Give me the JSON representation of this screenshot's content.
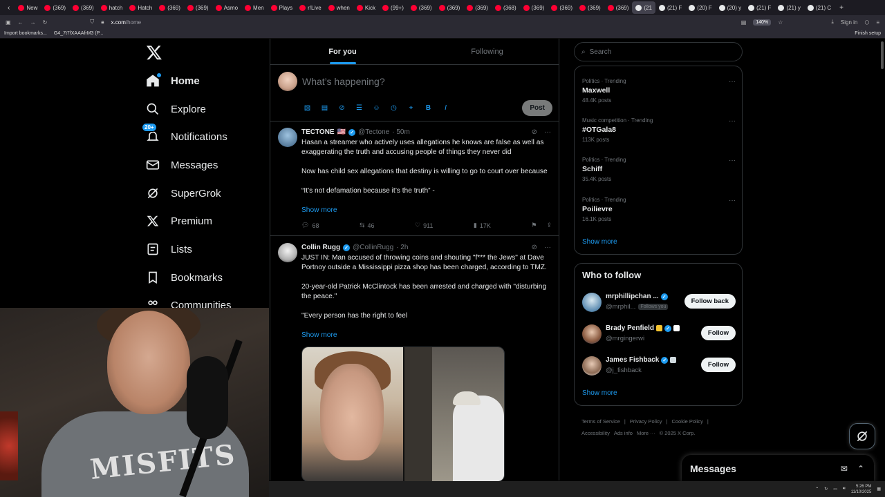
{
  "browser": {
    "tabs": [
      {
        "label": "New"
      },
      {
        "label": "(369)"
      },
      {
        "label": "(369)"
      },
      {
        "label": "hatch"
      },
      {
        "label": "Hatch"
      },
      {
        "label": "(369)"
      },
      {
        "label": "(369)"
      },
      {
        "label": "Asmo"
      },
      {
        "label": "Men"
      },
      {
        "label": "Plays"
      },
      {
        "label": "r/Live"
      },
      {
        "label": "when"
      },
      {
        "label": "Kick"
      },
      {
        "label": "(99+)"
      },
      {
        "label": "(369)"
      },
      {
        "label": "(369)"
      },
      {
        "label": "(369)"
      },
      {
        "label": "(368)"
      },
      {
        "label": "(369)"
      },
      {
        "label": "(369)"
      },
      {
        "label": "(369)"
      },
      {
        "label": "(369)"
      },
      {
        "label": "(21"
      },
      {
        "label": "(21) F"
      },
      {
        "label": "(20) F"
      },
      {
        "label": "(20) y"
      },
      {
        "label": "(21) F"
      },
      {
        "label": "(21) y"
      },
      {
        "label": "(21) C"
      }
    ],
    "url_host": "x.com",
    "url_path": "/home",
    "zoom": "140%",
    "sign_in": "Sign in",
    "bookmarks": [
      "Import bookmarks...",
      "G4_7t7fXAAAfrM3 (P..."
    ],
    "finish_setup": "Finish setup"
  },
  "nav": {
    "items": [
      {
        "label": "Home",
        "icon": "home-icon"
      },
      {
        "label": "Explore",
        "icon": "search-icon"
      },
      {
        "label": "Notifications",
        "icon": "bell-icon"
      },
      {
        "label": "Messages",
        "icon": "mail-icon"
      },
      {
        "label": "SuperGrok",
        "icon": "grok-icon"
      },
      {
        "label": "Premium",
        "icon": "x-icon"
      },
      {
        "label": "Lists",
        "icon": "list-icon"
      },
      {
        "label": "Bookmarks",
        "icon": "bookmark-icon"
      },
      {
        "label": "Communities",
        "icon": "communities-icon"
      }
    ],
    "notif_badge": "20+"
  },
  "feed": {
    "tabs": [
      "For you",
      "Following"
    ],
    "compose_placeholder": "What’s happening?",
    "post_button": "Post",
    "tweets": [
      {
        "name": "TECTONE",
        "flag": "🇺🇸",
        "handle": "@Tectone",
        "time": "· 50m",
        "paragraphs": [
          "Hasan a streamer who actively uses allegations he knows are false as well as exaggerating the truth and accusing people of things they never did",
          "Now has child sex allegations that destiny is willing to go to court over because",
          "“It’s not defamation because it’s the truth” -"
        ],
        "show_more": "Show more",
        "replies": "68",
        "reposts": "46",
        "likes": "911",
        "views": "17K"
      },
      {
        "name": "Collin Rugg",
        "handle": "@CollinRugg",
        "time": "· 2h",
        "paragraphs": [
          "JUST IN: Man accused of throwing coins and shouting \"f*** the Jews\" at Dave Portnoy outside a Mississippi pizza shop has been charged, according to TMZ.",
          "20-year-old Patrick McClintock has been arrested and charged with \"disturbing the peace.\"",
          "\"Every person has the right to feel"
        ],
        "show_more": "Show more"
      }
    ]
  },
  "right": {
    "search_placeholder": "Search",
    "trends": [
      {
        "meta": "Politics · Trending",
        "title": "Maxwell",
        "count": "48.4K posts"
      },
      {
        "meta": "Music competition · Trending",
        "title": "#OTGala8",
        "count": "113K posts"
      },
      {
        "meta": "Politics · Trending",
        "title": "Schiff",
        "count": "35.4K posts"
      },
      {
        "meta": "Politics · Trending",
        "title": "Poilievre",
        "count": "16.1K posts"
      }
    ],
    "trends_show_more": "Show more",
    "who_to_follow_title": "Who to follow",
    "who_to_follow": [
      {
        "name": "mrphillipchan ...",
        "handle": "@mrphil...",
        "follows_you": "Follows you",
        "button": "Follow back"
      },
      {
        "name": "Brady Penfield",
        "handle": "@mrgingerwi",
        "button": "Follow"
      },
      {
        "name": "James Fishback",
        "handle": "@j_fishback",
        "button": "Follow"
      }
    ],
    "wtf_show_more": "Show more",
    "footer": [
      "Terms of Service",
      "|",
      "Privacy Policy",
      "|",
      "Cookie Policy",
      "|",
      "Accessibility",
      "Ads info",
      "More ···",
      "© 2025 X Corp."
    ]
  },
  "messages_drawer": {
    "title": "Messages"
  },
  "taskbar": {
    "time": "5:26 PM",
    "date": "11/10/2025"
  },
  "colors": {
    "accent": "#1d9bf0",
    "background": "#000000",
    "border": "#2f3336",
    "muted": "#71767b"
  }
}
